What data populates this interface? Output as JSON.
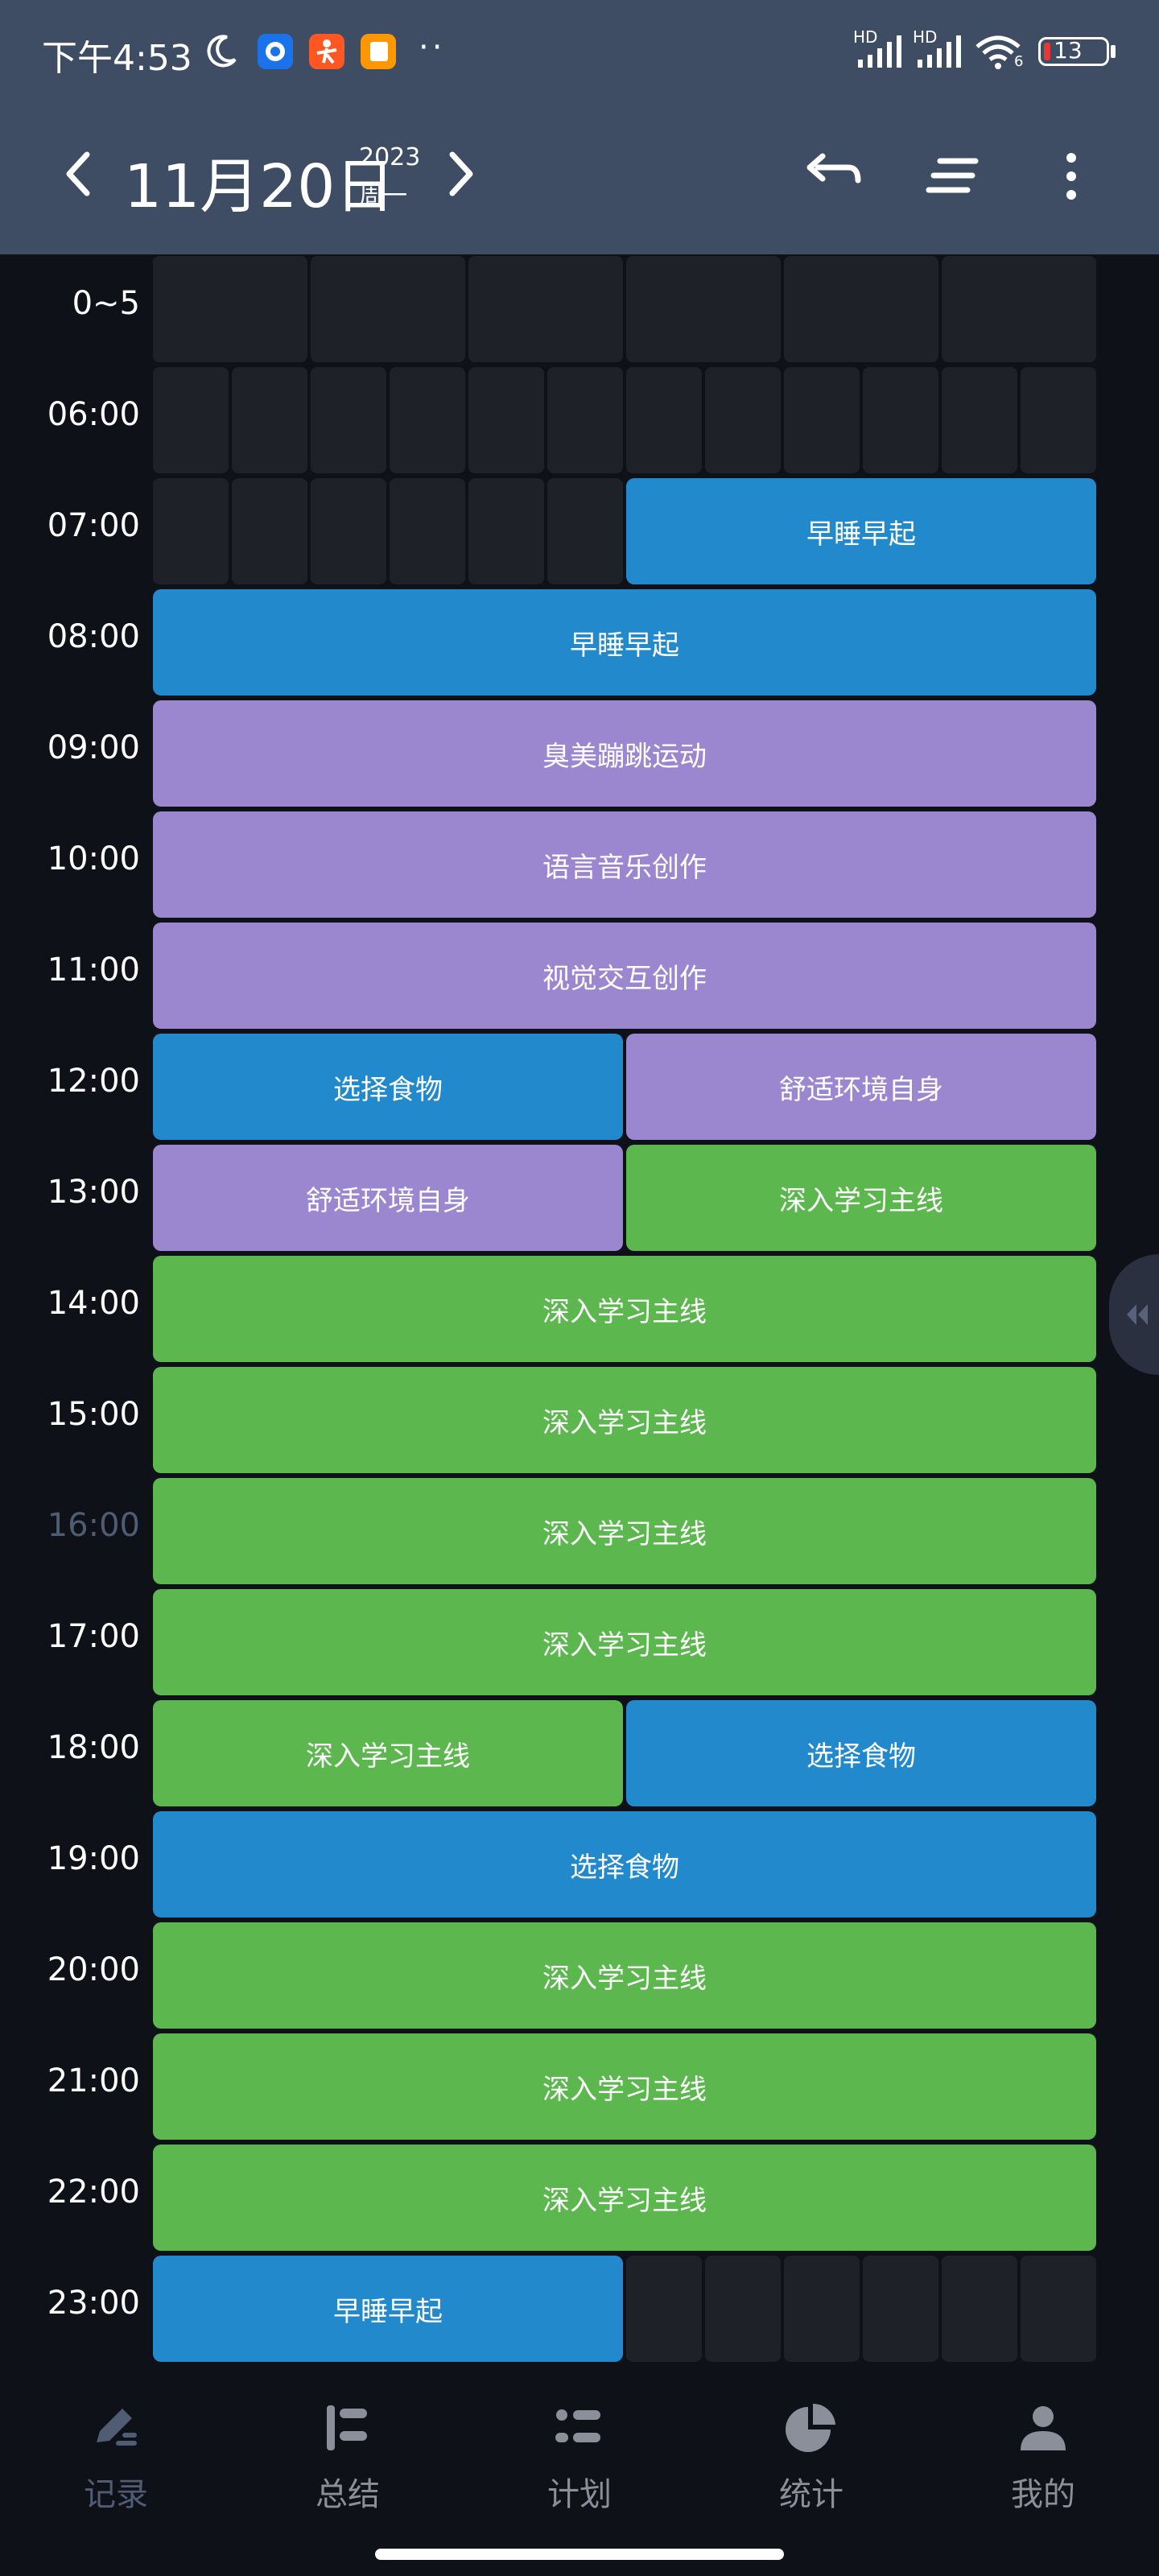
{
  "status_bar": {
    "time": "下午4:53",
    "dots": "··",
    "signal1_tag": "HD",
    "signal2_tag": "HD",
    "wifi_tag": "6",
    "battery": "13"
  },
  "header": {
    "date": "11月20日",
    "year": "2023",
    "weekday": "周一"
  },
  "time_labels": [
    "0~5",
    "06:00",
    "07:00",
    "08:00",
    "09:00",
    "10:00",
    "11:00",
    "12:00",
    "13:00",
    "14:00",
    "15:00",
    "16:00",
    "17:00",
    "18:00",
    "19:00",
    "20:00",
    "21:00",
    "22:00",
    "23:00"
  ],
  "current_hour_label": "16:00",
  "colors": {
    "sleep": "#2189cc",
    "food": "#2189cc",
    "create": "#9b87d0",
    "study": "#5cb84e",
    "empty_cell": "#1e2128",
    "header_bg": "#3f4d64",
    "current_hour": "#4f5c74"
  },
  "rows": [
    {
      "label": "0~5",
      "segments": [
        {
          "empty": true,
          "cols": 2
        },
        {
          "empty": true,
          "cols": 2
        },
        {
          "empty": true,
          "cols": 2
        },
        {
          "empty": true,
          "cols": 2
        },
        {
          "empty": true,
          "cols": 2
        },
        {
          "empty": true,
          "cols": 2
        }
      ]
    },
    {
      "label": "06:00",
      "segments": [
        {
          "empty": true,
          "cols": 1
        },
        {
          "empty": true,
          "cols": 1
        },
        {
          "empty": true,
          "cols": 1
        },
        {
          "empty": true,
          "cols": 1
        },
        {
          "empty": true,
          "cols": 1
        },
        {
          "empty": true,
          "cols": 1
        },
        {
          "empty": true,
          "cols": 1
        },
        {
          "empty": true,
          "cols": 1
        },
        {
          "empty": true,
          "cols": 1
        },
        {
          "empty": true,
          "cols": 1
        },
        {
          "empty": true,
          "cols": 1
        },
        {
          "empty": true,
          "cols": 1
        }
      ]
    },
    {
      "label": "07:00",
      "segments": [
        {
          "empty": true,
          "cols": 1
        },
        {
          "empty": true,
          "cols": 1
        },
        {
          "empty": true,
          "cols": 1
        },
        {
          "empty": true,
          "cols": 1
        },
        {
          "empty": true,
          "cols": 1
        },
        {
          "empty": true,
          "cols": 1
        },
        {
          "text": "早睡早起",
          "color": "sleep",
          "cols": 6
        }
      ]
    },
    {
      "label": "08:00",
      "segments": [
        {
          "text": "早睡早起",
          "color": "sleep",
          "cols": 12
        }
      ]
    },
    {
      "label": "09:00",
      "segments": [
        {
          "text": "臭美蹦跳运动",
          "color": "create",
          "cols": 12
        }
      ]
    },
    {
      "label": "10:00",
      "segments": [
        {
          "text": "语言音乐创作",
          "color": "create",
          "cols": 12
        }
      ]
    },
    {
      "label": "11:00",
      "segments": [
        {
          "text": "视觉交互创作",
          "color": "create",
          "cols": 12
        }
      ]
    },
    {
      "label": "12:00",
      "segments": [
        {
          "text": "选择食物",
          "color": "food",
          "cols": 6
        },
        {
          "text": "舒适环境自身",
          "color": "create",
          "cols": 6
        }
      ]
    },
    {
      "label": "13:00",
      "segments": [
        {
          "text": "舒适环境自身",
          "color": "create",
          "cols": 6
        },
        {
          "text": "深入学习主线",
          "color": "study",
          "cols": 6
        }
      ]
    },
    {
      "label": "14:00",
      "segments": [
        {
          "text": "深入学习主线",
          "color": "study",
          "cols": 12
        }
      ]
    },
    {
      "label": "15:00",
      "segments": [
        {
          "text": "深入学习主线",
          "color": "study",
          "cols": 12
        }
      ]
    },
    {
      "label": "16:00",
      "segments": [
        {
          "text": "深入学习主线",
          "color": "study",
          "cols": 12
        }
      ]
    },
    {
      "label": "17:00",
      "segments": [
        {
          "text": "深入学习主线",
          "color": "study",
          "cols": 12
        }
      ]
    },
    {
      "label": "18:00",
      "segments": [
        {
          "text": "深入学习主线",
          "color": "study",
          "cols": 6
        },
        {
          "text": "选择食物",
          "color": "food",
          "cols": 6
        }
      ]
    },
    {
      "label": "19:00",
      "segments": [
        {
          "text": "选择食物",
          "color": "food",
          "cols": 12
        }
      ]
    },
    {
      "label": "20:00",
      "segments": [
        {
          "text": "深入学习主线",
          "color": "study",
          "cols": 12
        }
      ]
    },
    {
      "label": "21:00",
      "segments": [
        {
          "text": "深入学习主线",
          "color": "study",
          "cols": 12
        }
      ]
    },
    {
      "label": "22:00",
      "segments": [
        {
          "text": "深入学习主线",
          "color": "study",
          "cols": 12
        }
      ]
    },
    {
      "label": "23:00",
      "segments": [
        {
          "text": "早睡早起",
          "color": "sleep",
          "cols": 6
        },
        {
          "empty": true,
          "cols": 1
        },
        {
          "empty": true,
          "cols": 1
        },
        {
          "empty": true,
          "cols": 1
        },
        {
          "empty": true,
          "cols": 1
        },
        {
          "empty": true,
          "cols": 1
        },
        {
          "empty": true,
          "cols": 1
        }
      ]
    }
  ],
  "bottom_nav": [
    {
      "label": "记录",
      "icon": "pen-record-icon",
      "active": true
    },
    {
      "label": "总结",
      "icon": "summary-bars-icon",
      "active": false
    },
    {
      "label": "计划",
      "icon": "plan-list-icon",
      "active": false
    },
    {
      "label": "统计",
      "icon": "pie-chart-icon",
      "active": false
    },
    {
      "label": "我的",
      "icon": "profile-person-icon",
      "active": false
    }
  ]
}
